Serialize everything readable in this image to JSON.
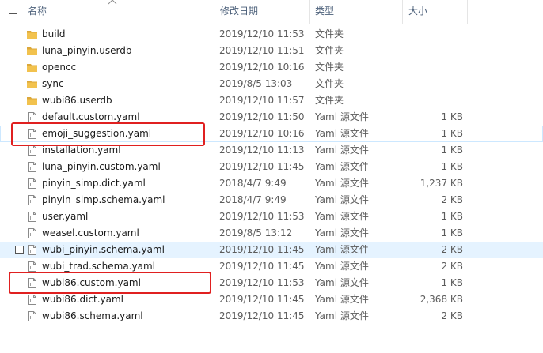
{
  "columns": {
    "name": "名称",
    "date": "修改日期",
    "type": "类型",
    "size": "大小"
  },
  "files": [
    {
      "name": "build",
      "date": "2019/12/10 11:53",
      "type": "文件夹",
      "size": "",
      "kind": "folder"
    },
    {
      "name": "luna_pinyin.userdb",
      "date": "2019/12/10 11:51",
      "type": "文件夹",
      "size": "",
      "kind": "folder"
    },
    {
      "name": "opencc",
      "date": "2019/12/10 10:16",
      "type": "文件夹",
      "size": "",
      "kind": "folder"
    },
    {
      "name": "sync",
      "date": "2019/8/5 13:03",
      "type": "文件夹",
      "size": "",
      "kind": "folder"
    },
    {
      "name": "wubi86.userdb",
      "date": "2019/12/10 11:57",
      "type": "文件夹",
      "size": "",
      "kind": "folder"
    },
    {
      "name": "default.custom.yaml",
      "date": "2019/12/10 11:50",
      "type": "Yaml 源文件",
      "size": "1 KB",
      "kind": "file"
    },
    {
      "name": "emoji_suggestion.yaml",
      "date": "2019/12/10 10:16",
      "type": "Yaml 源文件",
      "size": "1 KB",
      "kind": "file"
    },
    {
      "name": "installation.yaml",
      "date": "2019/12/10 11:13",
      "type": "Yaml 源文件",
      "size": "1 KB",
      "kind": "file"
    },
    {
      "name": "luna_pinyin.custom.yaml",
      "date": "2019/12/10 11:45",
      "type": "Yaml 源文件",
      "size": "1 KB",
      "kind": "file"
    },
    {
      "name": "pinyin_simp.dict.yaml",
      "date": "2018/4/7 9:49",
      "type": "Yaml 源文件",
      "size": "1,237 KB",
      "kind": "file"
    },
    {
      "name": "pinyin_simp.schema.yaml",
      "date": "2018/4/7 9:49",
      "type": "Yaml 源文件",
      "size": "2 KB",
      "kind": "file"
    },
    {
      "name": "user.yaml",
      "date": "2019/12/10 11:53",
      "type": "Yaml 源文件",
      "size": "1 KB",
      "kind": "file"
    },
    {
      "name": "weasel.custom.yaml",
      "date": "2019/8/5 13:12",
      "type": "Yaml 源文件",
      "size": "1 KB",
      "kind": "file"
    },
    {
      "name": "wubi_pinyin.schema.yaml",
      "date": "2019/12/10 11:45",
      "type": "Yaml 源文件",
      "size": "2 KB",
      "kind": "file"
    },
    {
      "name": "wubi_trad.schema.yaml",
      "date": "2019/12/10 11:45",
      "type": "Yaml 源文件",
      "size": "2 KB",
      "kind": "file"
    },
    {
      "name": "wubi86.custom.yaml",
      "date": "2019/12/10 11:53",
      "type": "Yaml 源文件",
      "size": "1 KB",
      "kind": "file"
    },
    {
      "name": "wubi86.dict.yaml",
      "date": "2019/12/10 11:45",
      "type": "Yaml 源文件",
      "size": "2,368 KB",
      "kind": "file"
    },
    {
      "name": "wubi86.schema.yaml",
      "date": "2019/12/10 11:45",
      "type": "Yaml 源文件",
      "size": "2 KB",
      "kind": "file"
    }
  ],
  "hover_row_index": 13,
  "selected_row_index": 6,
  "highlight_row_indices": [
    6,
    15
  ],
  "colors": {
    "folder": "#f2c24e",
    "folder_dark": "#dca83a",
    "hover": "#e5f3ff",
    "highlight_box": "#e02020",
    "header_text": "#4c607a"
  }
}
